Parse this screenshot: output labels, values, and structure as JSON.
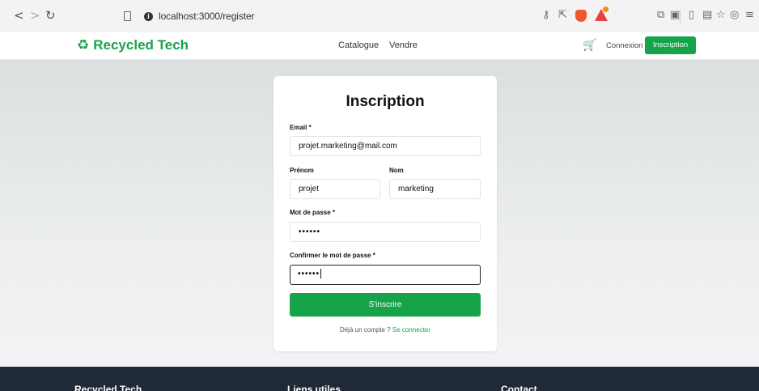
{
  "browser": {
    "back_glyph": "<",
    "forward_glyph": ">",
    "reload_glyph": "↻",
    "url": "localhost:3000/register",
    "right_icons": [
      "key-icon",
      "share-icon",
      "brave-shields-icon",
      "brave-rewards-icon",
      "extensions-icon",
      "screenshot-icon",
      "sidebar-icon",
      "wallet-icon",
      "bookmarks-icon",
      "vpn-icon",
      "menu-icon"
    ]
  },
  "header": {
    "brand": "Recycled Tech",
    "nav": [
      "Catalogue",
      "Vendre"
    ],
    "login": "Connexion",
    "signup": "Inscription"
  },
  "form": {
    "title": "Inscription",
    "email_label": "Email *",
    "email_value": "projet.marketing@mail.com",
    "firstname_label": "Prénom",
    "firstname_value": "projet",
    "lastname_label": "Nom",
    "lastname_value": "marketing",
    "password_label": "Mot de passe *",
    "password_value": "••••••",
    "confirm_label": "Confirmer le mot de passe *",
    "confirm_value": "••••••",
    "submit": "S'inscrire",
    "already_text": "Déjà un compte ?",
    "login_link": "Se connecter"
  },
  "footer": {
    "columns": [
      "Recycled Tech",
      "Liens utiles",
      "Contact"
    ]
  },
  "colors": {
    "brand_green": "#16a34a",
    "footer_bg": "#1f2937"
  }
}
